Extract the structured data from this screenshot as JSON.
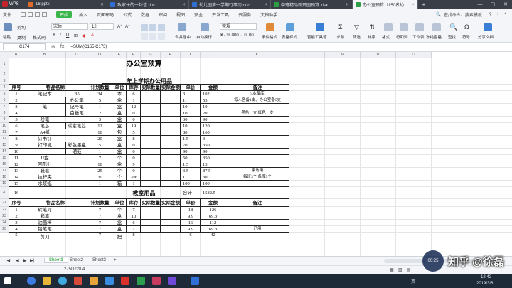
{
  "app": {
    "name": "WPS"
  },
  "doc_tabs": [
    {
      "label": "16.pptx",
      "color": "#e06c2c",
      "active": false
    },
    {
      "label": "致家长的一封信.doc",
      "color": "#2f6fd6",
      "active": false
    },
    {
      "label": "幼儿园第一学期行事历.doc",
      "color": "#2f6fd6",
      "active": false
    },
    {
      "label": "中班精品新开园预算.xlsx",
      "color": "#2e9e44",
      "active": false
    },
    {
      "label": "办公室预算（150名幼儿参照）.xls",
      "color": "#2e9e44",
      "active": true
    }
  ],
  "menu": {
    "file": "文件",
    "start": "开始",
    "items": [
      "插入",
      "页面布局",
      "公式",
      "数据",
      "审阅",
      "视图",
      "安全",
      "开发工具",
      "云服务",
      "文档助手"
    ],
    "search": "查找命令、搜索模板"
  },
  "toolbar": {
    "paste": "粘贴",
    "cut": "剪切",
    "copy": "复制",
    "format_painter": "格式刷",
    "font_name": "宋体",
    "font_size": "12",
    "merge_center": "合并居中",
    "wrap_text": "自动换行",
    "number_format": "常规",
    "conditional_format": "条件格式",
    "table_style": "表格样式",
    "smart_toolbox": "智能工具箱",
    "sum": "求和",
    "filter": "筛选",
    "sort": "排序",
    "format": "格式",
    "row_col": "行和列",
    "worksheet": "工作表",
    "freeze": "冻结窗格",
    "find": "查找",
    "symbol": "符号",
    "share": "分享文档"
  },
  "formula_bar": {
    "cell_ref": "C174",
    "fx": "fx",
    "formula": "=SUM(C165:C173)"
  },
  "columns": [
    "A",
    "B",
    "C",
    "D",
    "E",
    "F",
    "G",
    "H",
    "I",
    "J",
    "K",
    "L",
    "M",
    "N",
    "O"
  ],
  "rows": [
    "1",
    "2",
    "3",
    "4",
    "5",
    "6",
    "7",
    "8",
    "9",
    "10",
    "11",
    "12",
    "13",
    "14",
    "15",
    "16",
    "17",
    "18",
    "19",
    "20",
    "21",
    "22",
    "23",
    "24",
    "25"
  ],
  "sheet": {
    "title": "办公室预算",
    "subtitle": "年上学期办公用品",
    "section2": "教室用品",
    "headers": [
      "序号",
      "物品名称",
      "计划数量",
      "单位",
      "库存",
      "实际数量",
      "实际金额",
      "单价",
      "金额",
      "备注"
    ],
    "table1": [
      {
        "no": "1",
        "name": "笔记本",
        "spec": "B5",
        "qty": "34",
        "unit": "本",
        "stock": "6",
        "price": "3",
        "amount": "102",
        "note": "5本备库"
      },
      {
        "no": "2",
        "name": "",
        "spec": "办公笔",
        "qty": "5",
        "unit": "盒",
        "stock": "1",
        "price": "11",
        "amount": "55",
        "note": "每人各备1支、办公室备5支"
      },
      {
        "no": "3",
        "name": "笔",
        "spec": "记号笔",
        "qty": "1",
        "unit": "盒",
        "stock": "12",
        "price": "10",
        "amount": "10",
        "note": ""
      },
      {
        "no": "4",
        "name": "",
        "spec": "白板笔",
        "qty": "2",
        "unit": "盒",
        "stock": "0",
        "price": "10",
        "amount": "20",
        "note": "黑色一支 红色一支"
      },
      {
        "no": "5",
        "name": "粉笔",
        "spec": "",
        "qty": "3",
        "unit": "盒",
        "stock": "0",
        "price": "30",
        "amount": "90",
        "note": ""
      },
      {
        "no": "6",
        "name": "笔芯",
        "spec": "碳素笔芯",
        "qty": "12",
        "unit": "盒",
        "stock": "19",
        "price": "10",
        "amount": "120",
        "note": ""
      },
      {
        "no": "7",
        "name": "A4纸",
        "spec": "",
        "qty": "10",
        "unit": "包",
        "stock": "5",
        "price": "80",
        "amount": "160",
        "note": ""
      },
      {
        "no": "8",
        "name": "订书钉",
        "spec": "",
        "qty": "20",
        "unit": "盒",
        "stock": "8",
        "price": "1.5",
        "amount": "3",
        "note": ""
      },
      {
        "no": "9",
        "name": "打印机",
        "spec": "彩色墨盒",
        "qty": "5",
        "unit": "盒",
        "stock": "0",
        "price": "70",
        "amount": "350",
        "note": ""
      },
      {
        "no": "10",
        "name": "",
        "spec": "硒鼓",
        "qty": "1",
        "unit": "盒",
        "stock": "0",
        "price": "90",
        "amount": "90",
        "note": ""
      },
      {
        "no": "11",
        "name": "U盘",
        "spec": "",
        "qty": "7",
        "unit": "个",
        "stock": "0",
        "price": "50",
        "amount": "350",
        "note": ""
      },
      {
        "no": "12",
        "name": "回形针",
        "spec": "",
        "qty": "10",
        "unit": "盒",
        "stock": "9",
        "price": "1.5",
        "amount": "15",
        "note": ""
      },
      {
        "no": "13",
        "name": "鞋套",
        "spec": "",
        "qty": "25",
        "unit": "个",
        "stock": "0",
        "price": "3.5",
        "amount": "87.5",
        "note": "家访用"
      },
      {
        "no": "14",
        "name": "拉杆夹",
        "spec": "",
        "qty": "30",
        "unit": "个",
        "stock": "206",
        "price": "1",
        "amount": "30",
        "note": "每班3个 备库9个"
      },
      {
        "no": "15",
        "name": "水浆纸",
        "spec": "",
        "qty": "1",
        "unit": "箱",
        "stock": "1",
        "price": "100",
        "amount": "100",
        "note": ""
      },
      {
        "no": "16",
        "name": "",
        "spec": "",
        "qty": "",
        "unit": "",
        "stock": "",
        "price": "合计",
        "amount": "1582.5",
        "note": ""
      }
    ],
    "table2": [
      {
        "no": "1",
        "name": "转笔刀",
        "qty": "7",
        "unit": "个",
        "stock": "7",
        "price": "18",
        "amount": "126",
        "note": ""
      },
      {
        "no": "2",
        "name": "彩笔",
        "qty": "7",
        "unit": "盒",
        "stock": "10",
        "price": "9.9",
        "amount": "69.3",
        "note": ""
      },
      {
        "no": "3",
        "name": "油画棒",
        "qty": "7",
        "unit": "盒",
        "stock": "6",
        "price": "16",
        "amount": "112",
        "note": ""
      },
      {
        "no": "4",
        "name": "铅笔笔",
        "qty": "7",
        "unit": "盒",
        "stock": "1",
        "price": "9.9",
        "amount": "69.3",
        "note": "已用"
      },
      {
        "no": "5",
        "name": "剪刀",
        "qty": "7",
        "unit": "把",
        "stock": "8",
        "price": "6",
        "amount": "42",
        "note": ""
      }
    ]
  },
  "sheet_tabs": [
    "Sheet1",
    "Sheet2",
    "Sheet3",
    "+"
  ],
  "status": {
    "sum_text": "275D228.4"
  },
  "taskbar": {
    "time": "12:42",
    "date": "2019/3/6",
    "ime": "英"
  },
  "watermark": {
    "text": "知乎 @徐磊",
    "badge": "00:25"
  }
}
